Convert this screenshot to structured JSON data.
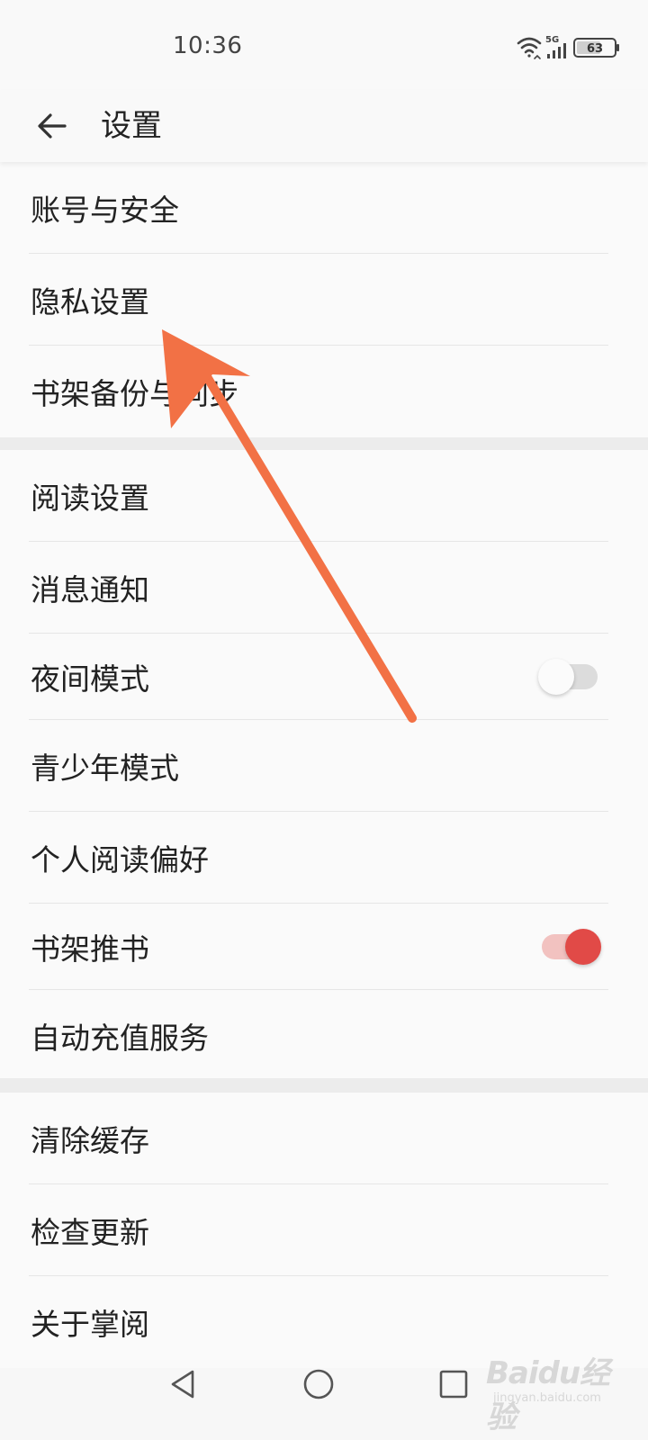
{
  "status_bar": {
    "time": "10:36",
    "network": "5G",
    "battery": "63"
  },
  "header": {
    "title": "设置"
  },
  "groups": [
    {
      "items": [
        {
          "label": "账号与安全"
        },
        {
          "label": "隐私设置"
        },
        {
          "label": "书架备份与同步"
        }
      ]
    },
    {
      "items": [
        {
          "label": "阅读设置"
        },
        {
          "label": "消息通知"
        },
        {
          "label": "夜间模式",
          "toggle": false
        },
        {
          "label": "青少年模式"
        },
        {
          "label": "个人阅读偏好"
        },
        {
          "label": "书架推书",
          "toggle": true
        },
        {
          "label": "自动充值服务"
        }
      ]
    },
    {
      "items": [
        {
          "label": "清除缓存"
        },
        {
          "label": "检查更新"
        },
        {
          "label": "关于掌阅"
        }
      ]
    }
  ],
  "colors": {
    "toggle_on": "#e14a47",
    "toggle_on_track": "#f2c2c0",
    "toggle_off_track": "#dcdcdc",
    "arrow": "#f27145"
  },
  "icons": {
    "back": "back-arrow-icon",
    "wifi": "wifi-icon",
    "signal": "signal-icon",
    "battery": "battery-icon",
    "nav_back": "triangle-back-icon",
    "nav_home": "circle-home-icon",
    "nav_recent": "square-recent-icon"
  },
  "watermark": {
    "logo": "Baidu经验",
    "sub": "jingyan.baidu.com"
  }
}
